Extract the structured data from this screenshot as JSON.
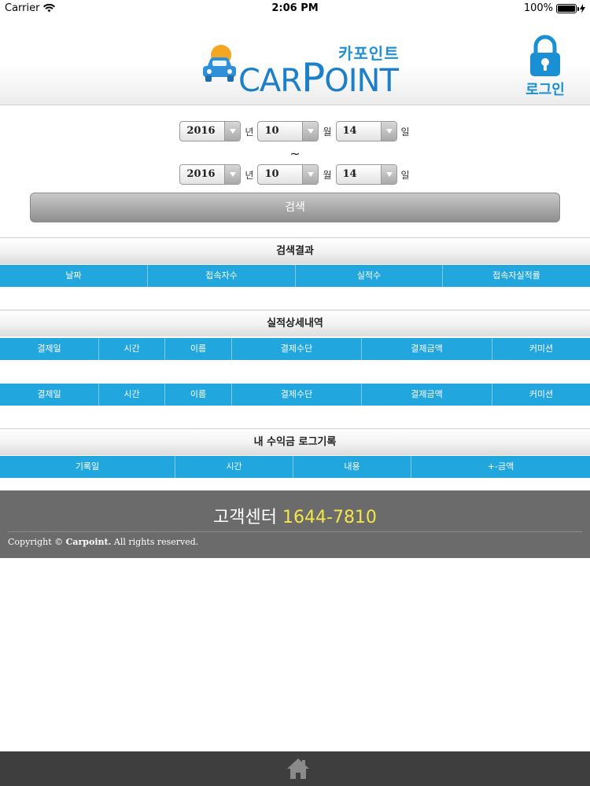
{
  "status_bar": {
    "carrier": "Carrier",
    "time": "2:06 PM",
    "battery": "100%"
  },
  "header": {
    "logo_korean": "카포인트",
    "logo_car": "CAR",
    "logo_p": "P",
    "logo_oint": "OINT",
    "login_label": "로그인",
    "colors": {
      "brand": "#1c7fc9",
      "accent": "#22a6de"
    }
  },
  "search": {
    "from": {
      "year": "2016",
      "month": "10",
      "day": "14"
    },
    "to": {
      "year": "2016",
      "month": "10",
      "day": "14"
    },
    "unit_year": "년",
    "unit_month": "월",
    "unit_day": "일",
    "tilde": "~",
    "button_label": "검색"
  },
  "results": {
    "title": "검색결과",
    "columns": [
      "날짜",
      "접속자수",
      "실적수",
      "접속자실적률"
    ]
  },
  "details": {
    "title": "실적상세내역",
    "columns": [
      "결제일",
      "시간",
      "이름",
      "결제수단",
      "결제금액",
      "커미션"
    ],
    "columns2": [
      "결제일",
      "시간",
      "이름",
      "결제수단",
      "결제금액",
      "커미션"
    ]
  },
  "revenue_log": {
    "title": "내 수익금 로그기록",
    "columns": [
      "기록일",
      "시간",
      "내용",
      "+-금액"
    ]
  },
  "footer": {
    "cs_label": "고객센터",
    "cs_phone": "1644-7810",
    "copyright_prefix": "Copyright © ",
    "copyright_brand": "Carpoint.",
    "copyright_suffix": " All rights reserved."
  }
}
